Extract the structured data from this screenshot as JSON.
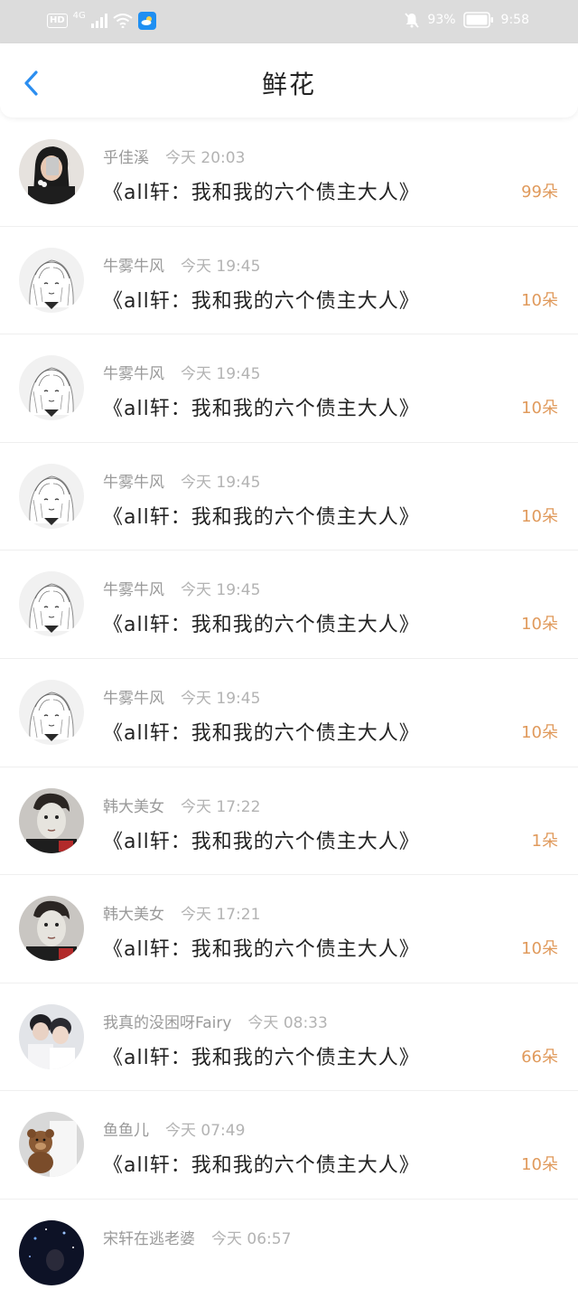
{
  "status_bar": {
    "network": "HD",
    "signal": "4G",
    "battery": "93%",
    "time": "9:58",
    "icons": [
      "hd-icon",
      "signal-icon",
      "wifi-icon",
      "weather-app-icon",
      "mute-bell-icon",
      "battery-icon"
    ]
  },
  "header": {
    "title": "鲜花",
    "back_icon": "back-chevron-icon",
    "accent": "#2b8ef0"
  },
  "colors": {
    "amount": "#e09a5c",
    "status_bar_bg": "#dcdcdc"
  },
  "records": [
    {
      "user": "乎佳溪",
      "time": "今天 20:03",
      "book": "《all轩：我和我的六个债主大人》",
      "amount": "99朵",
      "avatar": "girl-photo"
    },
    {
      "user": "牛雾牛风",
      "time": "今天 19:45",
      "book": "《all轩：我和我的六个债主大人》",
      "amount": "10朵",
      "avatar": "anime-sketch"
    },
    {
      "user": "牛雾牛风",
      "time": "今天 19:45",
      "book": "《all轩：我和我的六个债主大人》",
      "amount": "10朵",
      "avatar": "anime-sketch"
    },
    {
      "user": "牛雾牛风",
      "time": "今天 19:45",
      "book": "《all轩：我和我的六个债主大人》",
      "amount": "10朵",
      "avatar": "anime-sketch"
    },
    {
      "user": "牛雾牛风",
      "time": "今天 19:45",
      "book": "《all轩：我和我的六个债主大人》",
      "amount": "10朵",
      "avatar": "anime-sketch"
    },
    {
      "user": "牛雾牛风",
      "time": "今天 19:45",
      "book": "《all轩：我和我的六个债主大人》",
      "amount": "10朵",
      "avatar": "anime-sketch"
    },
    {
      "user": "韩大美女",
      "time": "今天 17:22",
      "book": "《all轩：我和我的六个债主大人》",
      "amount": "1朵",
      "avatar": "boy-facemask"
    },
    {
      "user": "韩大美女",
      "time": "今天 17:21",
      "book": "《all轩：我和我的六个债主大人》",
      "amount": "10朵",
      "avatar": "boy-facemask"
    },
    {
      "user": "我真的没困呀Fairy",
      "time": "今天 08:33",
      "book": "《all轩：我和我的六个债主大人》",
      "amount": "66朵",
      "avatar": "two-boys"
    },
    {
      "user": "鱼鱼儿",
      "time": "今天 07:49",
      "book": "《all轩：我和我的六个债主大人》",
      "amount": "10朵",
      "avatar": "teddy-bear"
    },
    {
      "user": "宋轩在逃老婆",
      "time": "今天 06:57",
      "book": "",
      "amount": "",
      "avatar": "night-stage"
    }
  ]
}
